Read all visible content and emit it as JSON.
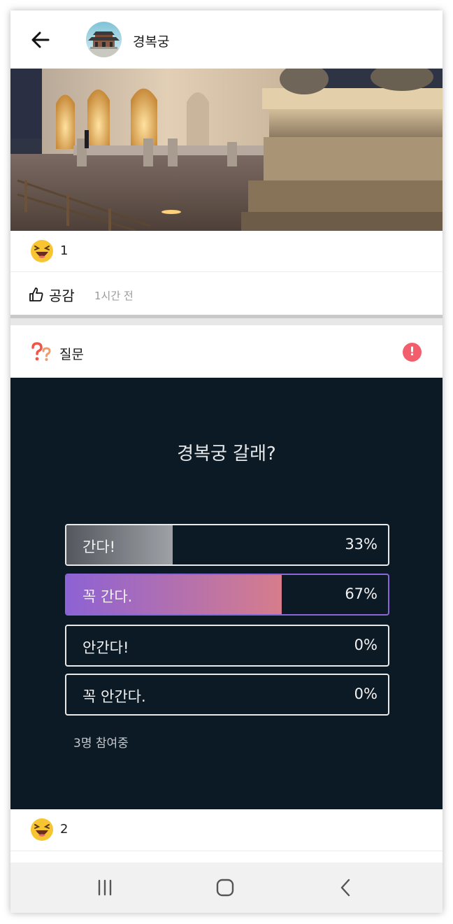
{
  "header": {
    "title": "경복궁",
    "back_icon": "arrow-left-icon",
    "avatar_icon": "palace-avatar"
  },
  "post": {
    "reaction_emoji": "laughing-face-icon",
    "reaction_count": "1",
    "like_label": "공감",
    "time": "1시간 전"
  },
  "question": {
    "label": "질문",
    "alert_symbol": "!",
    "poll": {
      "title": "경복궁 갈래?",
      "options": [
        {
          "label": "간다!",
          "percent": "33%",
          "fill": 0.33
        },
        {
          "label": "꼭 간다.",
          "percent": "67%",
          "fill": 0.67
        },
        {
          "label": "안간다!",
          "percent": "0%",
          "fill": 0
        },
        {
          "label": "꼭 안간다.",
          "percent": "0%",
          "fill": 0
        }
      ],
      "participants": "3명 참여중"
    },
    "reaction_count": "2"
  },
  "colors": {
    "poll_bg": "#0c1a25",
    "alert": "#f25e6b",
    "accent_purple": "#8d62d4",
    "accent_pink": "#d67d8c"
  },
  "navbar": {
    "recent": "recent-apps-icon",
    "home": "home-icon",
    "back": "nav-back-icon"
  }
}
